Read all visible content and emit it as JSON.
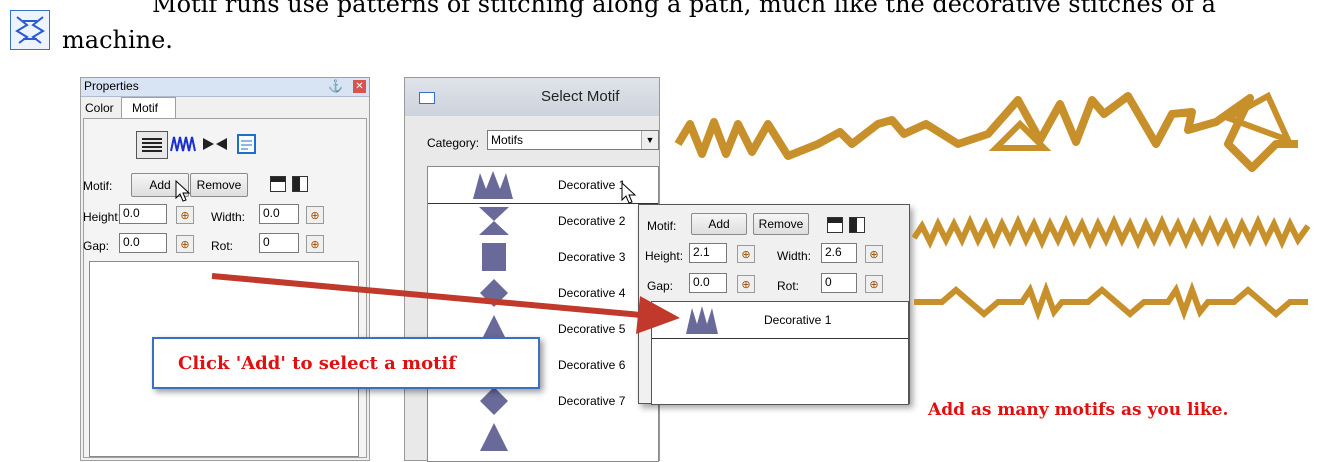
{
  "doc": {
    "line1": "Motif runs use patterns of stitching along a path, much like the decorative stitches of a",
    "line2": "machine."
  },
  "properties": {
    "title": "Properties",
    "tabs": [
      "Color",
      "Motif"
    ],
    "motif_label": "Motif:",
    "add_label": "Add",
    "remove_label": "Remove",
    "height_label": "Height:",
    "height_value": "0.0",
    "width_label": "Width:",
    "width_value": "0.0",
    "gap_label": "Gap:",
    "gap_value": "0.0",
    "rot_label": "Rot:",
    "rot_value": "0"
  },
  "select_motif": {
    "title": "Select Motif",
    "category_label": "Category:",
    "category_value": "Motifs",
    "items": [
      "Decorative 1",
      "Decorative 2",
      "Decorative 3",
      "Decorative 4",
      "Decorative 5",
      "Decorative 6",
      "Decorative 7"
    ]
  },
  "motif_panel": {
    "motif_label": "Motif:",
    "add_label": "Add",
    "remove_label": "Remove",
    "height_label": "Height:",
    "height_value": "2.1",
    "width_label": "Width:",
    "width_value": "2.6",
    "gap_label": "Gap:",
    "gap_value": "0.0",
    "rot_label": "Rot:",
    "rot_value": "0",
    "list_item": "Decorative 1"
  },
  "callouts": {
    "click_add": "Click 'Add' to select a motif",
    "add_many": "Add as many motifs as you like."
  },
  "colors": {
    "accent_red": "#e01010",
    "arrow": "#c0392b",
    "stitch": "#c8902a"
  }
}
